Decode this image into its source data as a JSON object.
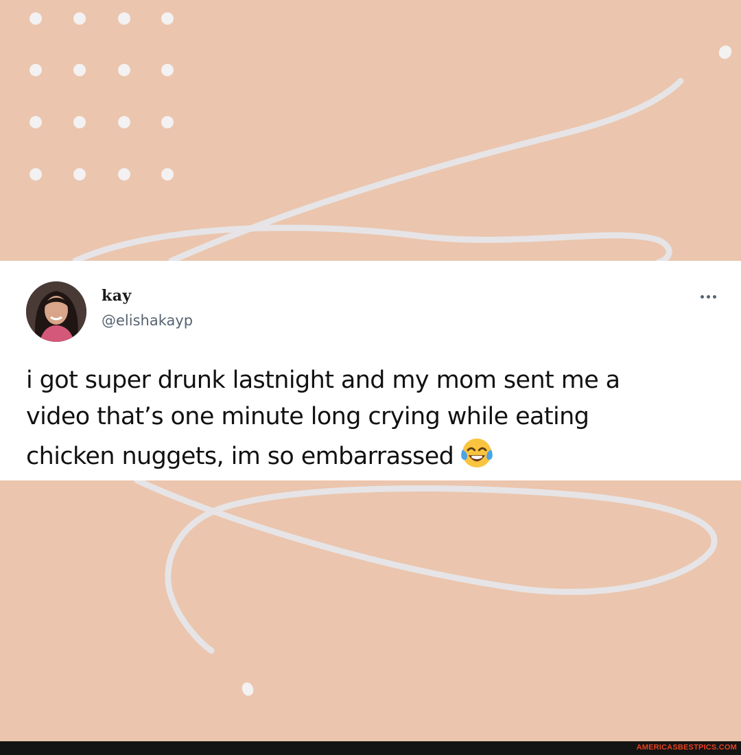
{
  "tweet": {
    "author_name": "kay",
    "author_handle": "@elishakayp",
    "text_lines": [
      "i got super drunk lastnight and my mom sent me a",
      "video that’s one minute long crying while eating",
      "chicken nuggets, im so embarrassed"
    ],
    "emoji": "face-with-tears-of-joy-icon"
  },
  "more_icon": "more-horizontal-icon",
  "watermark": "AMERICASBESTPICS.COM",
  "colors": {
    "background": "#ebc5ad",
    "card": "#ffffff",
    "decor": "#e6e4e6",
    "handle": "#566370",
    "watermark": "#e8421f"
  }
}
